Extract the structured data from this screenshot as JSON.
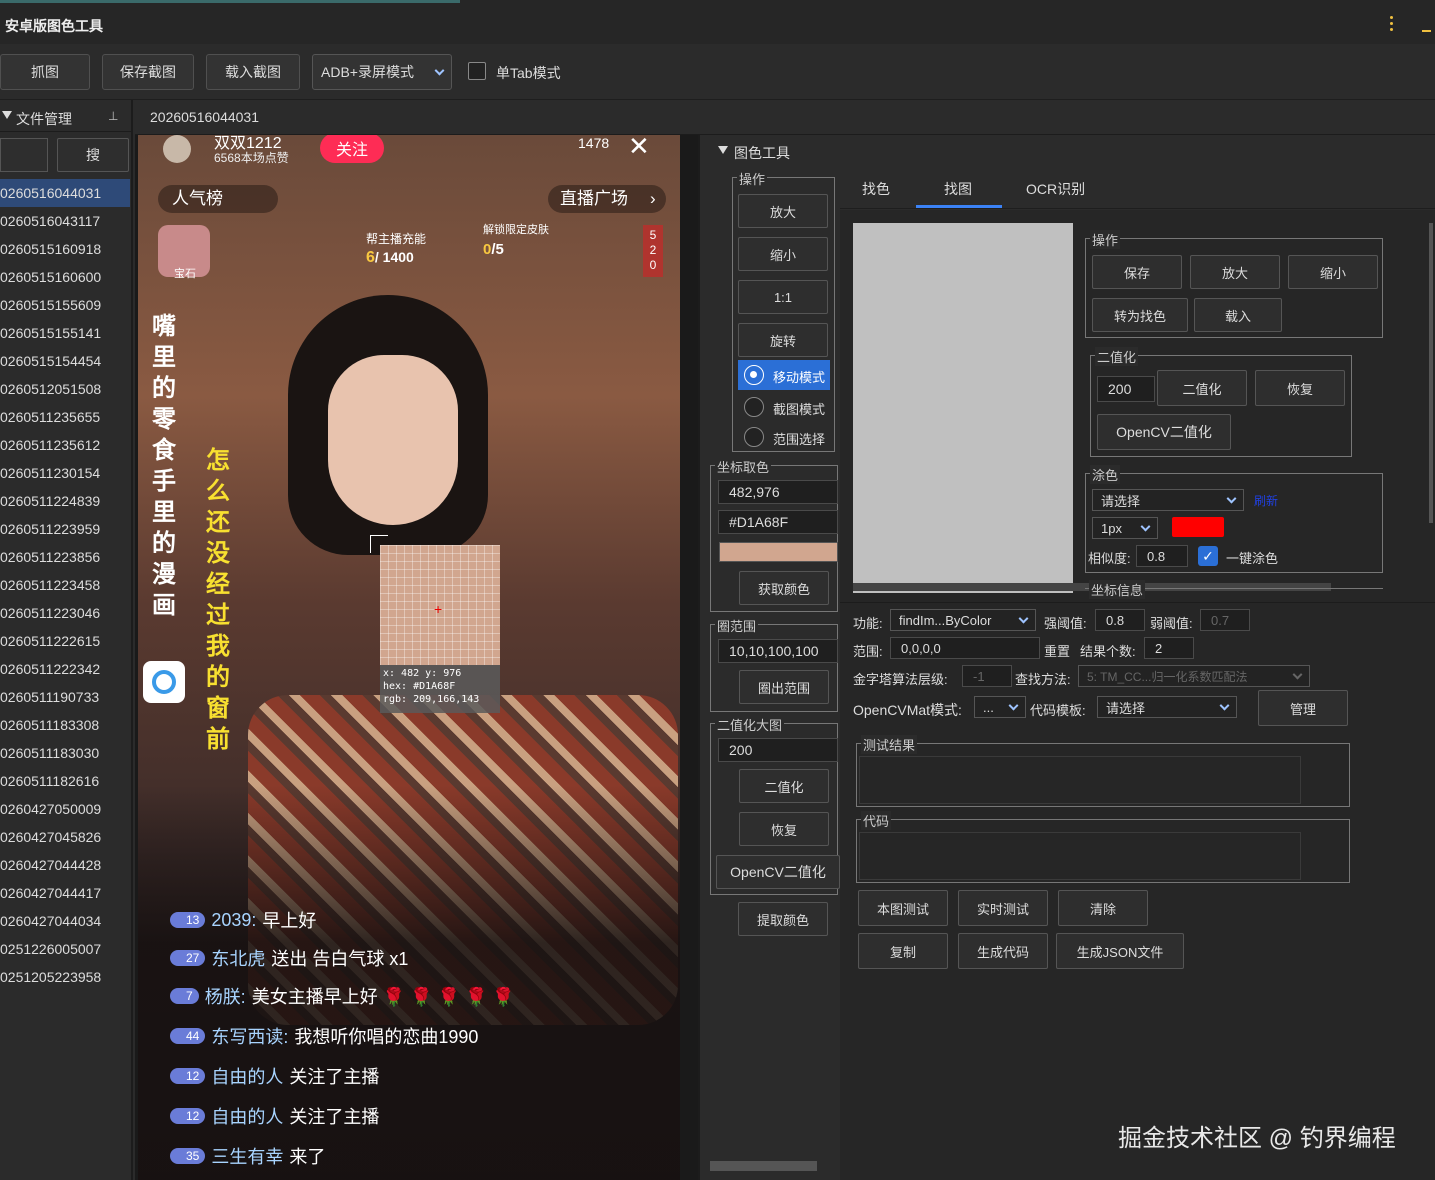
{
  "window": {
    "title": "安卓版图色工具",
    "menu_icon": "vertical-dots-icon",
    "minimize_icon": "minimize-icon"
  },
  "toolbar": {
    "capture": "抓图",
    "save_shot": "保存截图",
    "load_shot": "载入截图",
    "mode_select": "ADB+录屏模式",
    "single_tab_label": "单Tab模式"
  },
  "file_panel": {
    "title": "文件管理",
    "pin_icon": "pin-icon",
    "search_button": "搜",
    "search_placeholder": "",
    "files": [
      "0260516044031",
      "0260516043117",
      "0260515160918",
      "0260515160600",
      "0260515155609",
      "0260515155141",
      "0260515154454",
      "0260512051508",
      "0260511235655",
      "0260511235612",
      "0260511230154",
      "0260511224839",
      "0260511223959",
      "0260511223856",
      "0260511223458",
      "0260511223046",
      "0260511222615",
      "0260511222342",
      "0260511190733",
      "0260511183308",
      "0260511183030",
      "0260511182616",
      "0260427050009",
      "0260427045826",
      "0260427044428",
      "0260427044417",
      "0260427044034",
      "0251226005007",
      "0251205223958"
    ]
  },
  "doc_tab": "20260516044031",
  "screenshot": {
    "follow": "关注",
    "user": "双双1212",
    "likes": "6568本场点赞",
    "viewers": "1478",
    "popularity": "人气榜",
    "plaza": "直播广场",
    "charge_label": "帮主播充能",
    "charge_value_a": "6",
    "charge_value_b": "/ 1400",
    "unlock": "解锁限定皮肤",
    "unlock_count_a": "0",
    "unlock_count_b": "/5",
    "gem": "宝石",
    "side_nums": [
      "5",
      "2",
      "0"
    ],
    "vertical_left": "嘴里的零食手里的漫画",
    "vertical_right": "怎么还没经过我的窗前",
    "magnifier": {
      "coords": "x: 482 y: 976",
      "hex": "hex: #D1A68F",
      "rgb": "rgb: 209,166,143"
    },
    "comments": [
      {
        "level": "13",
        "name": "2039:",
        "text": "早上好"
      },
      {
        "level": "27",
        "name": "东北虎",
        "text": "送出 告白气球 x1"
      },
      {
        "level": "7",
        "name": "杨朕:",
        "text": "美女主播早上好 🌹 🌹 🌹 🌹 🌹"
      },
      {
        "level": "44",
        "name": "东写西读:",
        "text": "我想听你唱的恋曲1990"
      },
      {
        "level": "12",
        "name": "自由的人",
        "text": "关注了主播"
      },
      {
        "level": "12",
        "name": "自由的人",
        "text": "关注了主播"
      },
      {
        "level": "35",
        "name": "三生有幸",
        "text": "来了"
      }
    ]
  },
  "tools": {
    "title": "图色工具",
    "ops": {
      "label": "操作",
      "zoom_in": "放大",
      "zoom_out": "缩小",
      "one_to_one": "1:1",
      "rotate": "旋转",
      "move_mode": "移动模式",
      "crop_mode": "截图模式",
      "range_select": "范围选择"
    },
    "coord": {
      "label": "坐标取色",
      "coords": "482,976",
      "hex": "#D1A68F",
      "swatch": "#D1A68F",
      "get_color": "获取颜色"
    },
    "range": {
      "label": "圈范围",
      "value": "10,10,100,100",
      "draw": "圈出范围"
    },
    "binarize": {
      "label": "二值化大图",
      "value": "200",
      "binarize": "二值化",
      "restore": "恢复",
      "opencv": "OpenCV二值化"
    },
    "extract": "提取颜色"
  },
  "tabs": {
    "items": [
      "找色",
      "找图",
      "OCR识别"
    ],
    "active": "找图"
  },
  "find_image": {
    "ops": {
      "label": "操作",
      "save": "保存",
      "zoom_in": "放大",
      "zoom_out": "缩小",
      "to_findcolor": "转为找色",
      "load": "载入"
    },
    "binarize": {
      "label": "二值化",
      "value": "200",
      "binarize": "二值化",
      "restore": "恢复",
      "opencv": "OpenCV二值化"
    },
    "paint": {
      "label": "涂色",
      "select": "请选择",
      "link": "刷新",
      "size": "1px",
      "color": "#FF0000",
      "sim_label": "相似度:",
      "sim": "0.8",
      "oneclick": "一键涂色"
    },
    "coord_info_label": "坐标信息",
    "form": {
      "func_label": "功能:",
      "func": "findIm...ByColor",
      "strong_label": "强阈值:",
      "strong": "0.8",
      "weak_label": "弱阈值:",
      "weak": "0.7",
      "range_label": "范围:",
      "range": "0,0,0,0",
      "reset": "重置",
      "count_label": "结果个数:",
      "count": "2",
      "pyramid_label": "金字塔算法层级:",
      "pyramid": "-1",
      "method_label": "查找方法:",
      "method": "5: TM_CC...归一化系数匹配法",
      "mat_label": "OpenCVMat模式:",
      "mat": "...",
      "template_label": "代码模板:",
      "template": "请选择",
      "manage": "管理"
    },
    "result_label": "测试结果",
    "code_label": "代码",
    "buttons": {
      "test": "本图测试",
      "realtime": "实时测试",
      "clear": "清除",
      "copy": "复制",
      "gen_code": "生成代码",
      "gen_json": "生成JSON文件"
    }
  },
  "watermark": "掘金技术社区 @ 钓界编程"
}
